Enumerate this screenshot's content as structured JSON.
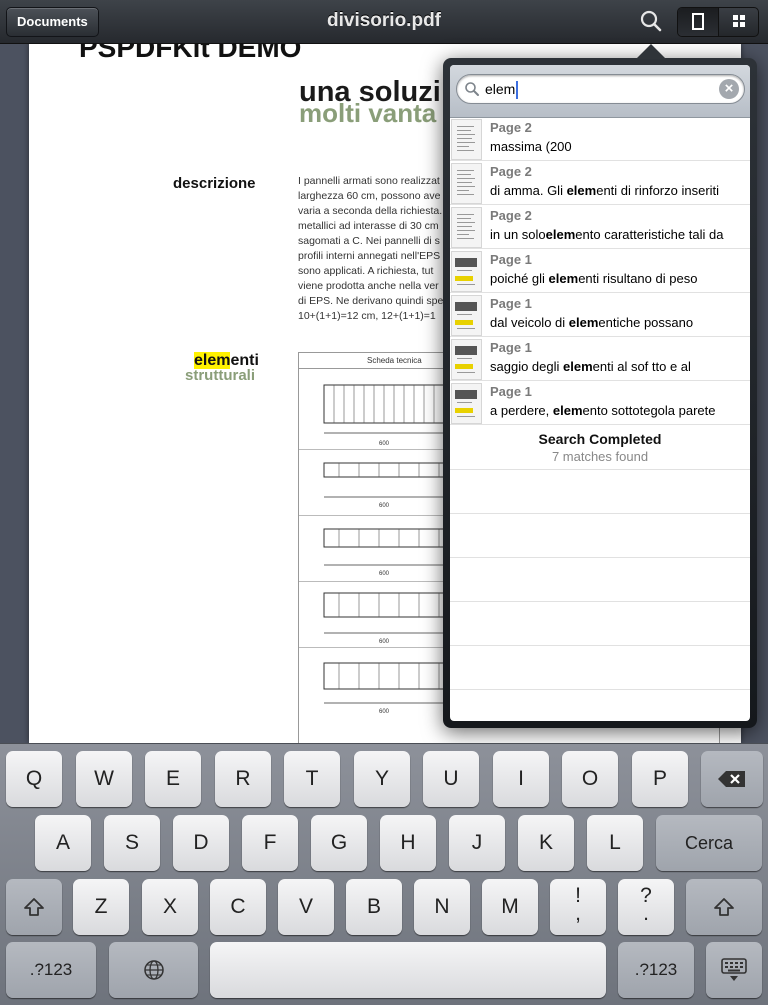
{
  "toolbar": {
    "documents_label": "Documents",
    "title": "divisorio.pdf"
  },
  "document": {
    "demo_title": "PSPDFKit DEMO",
    "heading_black": "una soluzi",
    "heading_green": "molti vanta",
    "description_label": "descrizione",
    "description_lines": [
      "I pannelli armati sono realizzat",
      "larghezza 60 cm, possono ave",
      "varia a seconda della richiesta.",
      "metallici ad interasse di 30 cm",
      "sagomati a C. Nei pannelli di s",
      "profili interni annegati nell'EPS",
      "sono applicati. A richiesta, tut",
      "viene prodotta anche nella ver",
      "di EPS. Ne derivano quindi spe",
      "10+(1+1)=12 cm, 12+(1+1)=1"
    ],
    "elementi_highlight": "elem",
    "elementi_rest": "enti",
    "strutturali": "strutturali",
    "scheda_title": "Scheda tecnica",
    "dimension_label": "600"
  },
  "search": {
    "query": "elem",
    "results": [
      {
        "page": "Page 2",
        "pre": "massima (200",
        "match": "",
        "post": ""
      },
      {
        "page": "Page 2",
        "pre": "di  amma. Gli ",
        "match": "elem",
        "post": "enti di rinforzo inseriti"
      },
      {
        "page": "Page 2",
        "pre": "in un solo",
        "match": "elem",
        "post": "ento caratteristiche tali da"
      },
      {
        "page": "Page 1",
        "pre": "poiché gli ",
        "match": "elem",
        "post": "enti risultano di peso"
      },
      {
        "page": "Page 1",
        "pre": "dal veicolo di ",
        "match": "elem",
        "post": "entiche possano"
      },
      {
        "page": "Page 1",
        "pre": " saggio degli ",
        "match": "elem",
        "post": "enti al sof tto e al"
      },
      {
        "page": "Page 1",
        "pre": "a perdere, ",
        "match": "elem",
        "post": "ento sottotegola parete"
      }
    ],
    "status_title": "Search Completed",
    "status_count": "7 matches found"
  },
  "keyboard": {
    "row1": [
      "Q",
      "W",
      "E",
      "R",
      "T",
      "Y",
      "U",
      "I",
      "O",
      "P"
    ],
    "row2": [
      "A",
      "S",
      "D",
      "F",
      "G",
      "H",
      "J",
      "K",
      "L"
    ],
    "row3": [
      "Z",
      "X",
      "C",
      "V",
      "B",
      "N",
      "M"
    ],
    "return_label": "Cerca",
    "numbers_label": ".?123",
    "excl_top": "!",
    "excl_bottom": ",",
    "quest_top": "?",
    "quest_bottom": "."
  },
  "icons": [
    "search-icon",
    "single-page-view-icon",
    "grid-view-icon",
    "clear-icon",
    "backspace-icon",
    "shift-icon",
    "globe-icon",
    "hide-keyboard-icon"
  ]
}
